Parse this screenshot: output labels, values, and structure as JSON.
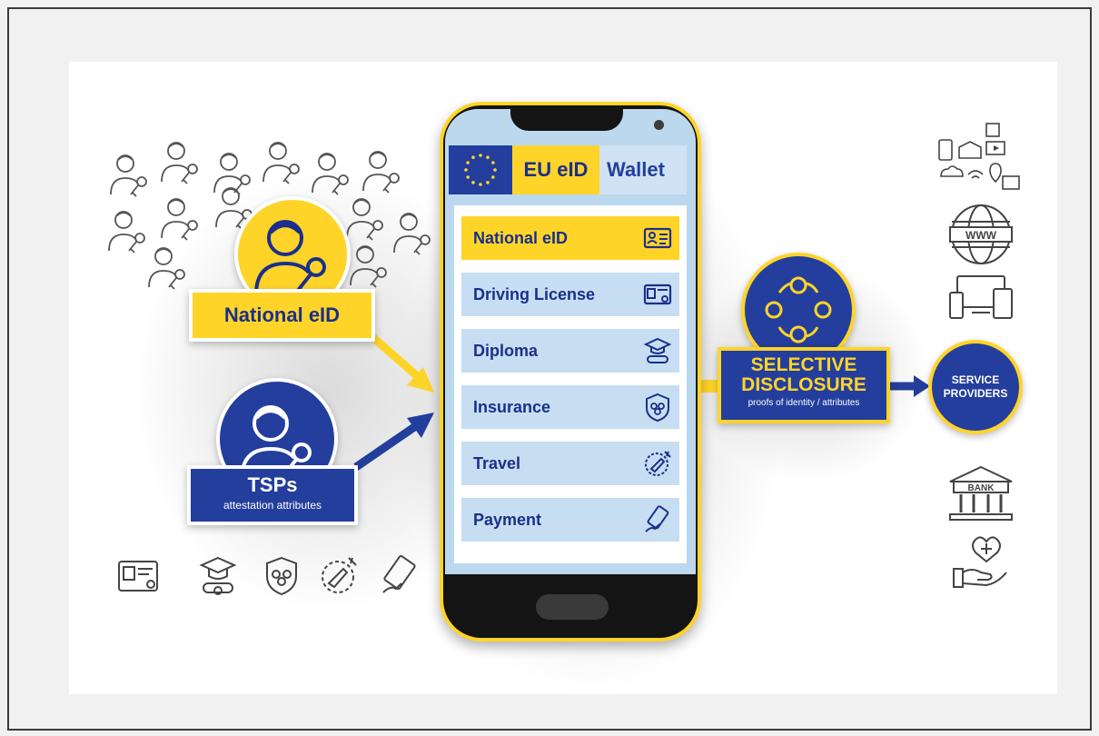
{
  "left": {
    "national_eid_label": "National eID",
    "tsps_title": "TSPs",
    "tsps_subtitle": "attestation attributes"
  },
  "phone": {
    "header_eu": "EU eID",
    "header_wallet": "Wallet",
    "cards": [
      {
        "label": "National eID",
        "icon": "id-card-icon",
        "active": true
      },
      {
        "label": "Driving License",
        "icon": "license-card-icon",
        "active": false
      },
      {
        "label": "Diploma",
        "icon": "diploma-icon",
        "active": false
      },
      {
        "label": "Insurance",
        "icon": "insurance-shield-icon",
        "active": false
      },
      {
        "label": "Travel",
        "icon": "travel-globe-icon",
        "active": false
      },
      {
        "label": "Payment",
        "icon": "payment-card-icon",
        "active": false
      }
    ]
  },
  "right": {
    "selective_title_line1": "SELECTIVE",
    "selective_title_line2": "DISCLOSURE",
    "selective_subtitle": "proofs of identity / attributes",
    "service_line1": "SERVICE",
    "service_line2": "PROVIDERS",
    "bank_label": "BANK",
    "www_label": "WWW"
  },
  "colors": {
    "eu_blue": "#233e9c",
    "eu_yellow": "#ffd429",
    "card_blue": "#c7def2",
    "text_navy": "#1b2f8a"
  }
}
